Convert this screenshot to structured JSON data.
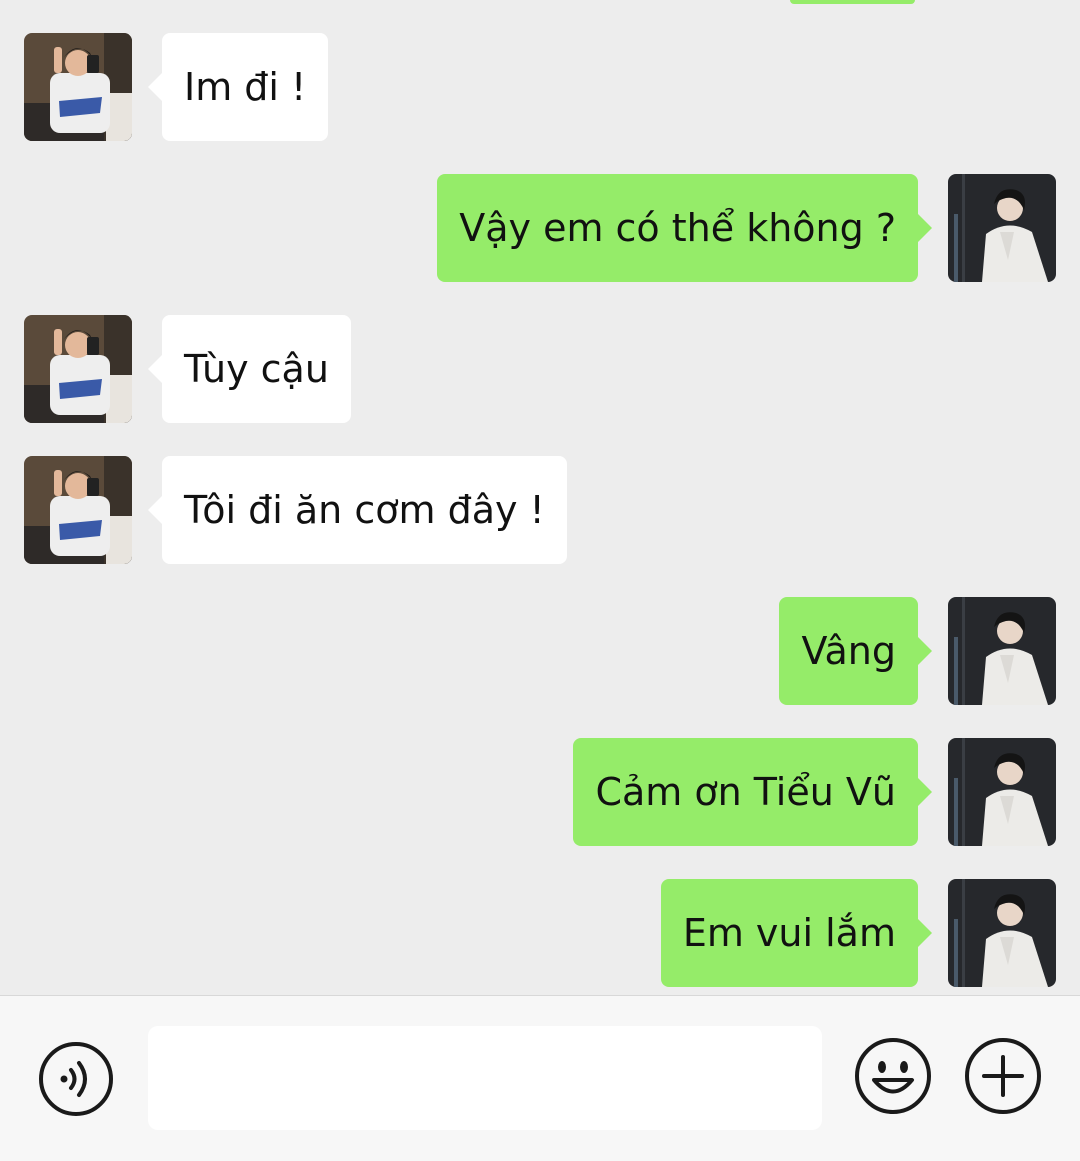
{
  "chat": {
    "messages": [
      {
        "sender": "other",
        "text": "Im đi !"
      },
      {
        "sender": "self",
        "text": "Vậy em có thể không ?"
      },
      {
        "sender": "other",
        "text": "Tùy cậu"
      },
      {
        "sender": "other",
        "text": "Tôi đi ăn cơm đây !"
      },
      {
        "sender": "self",
        "text": "Vâng"
      },
      {
        "sender": "self",
        "text": "Cảm ơn Tiểu Vũ"
      },
      {
        "sender": "self",
        "text": "Em vui lắm"
      }
    ]
  },
  "input_bar": {
    "voice_icon": "voice-icon",
    "input_value": "",
    "emoji_icon": "emoji-icon",
    "plus_icon": "plus-icon"
  },
  "colors": {
    "background": "#ededed",
    "self_bubble": "#95ec69",
    "other_bubble": "#ffffff"
  }
}
